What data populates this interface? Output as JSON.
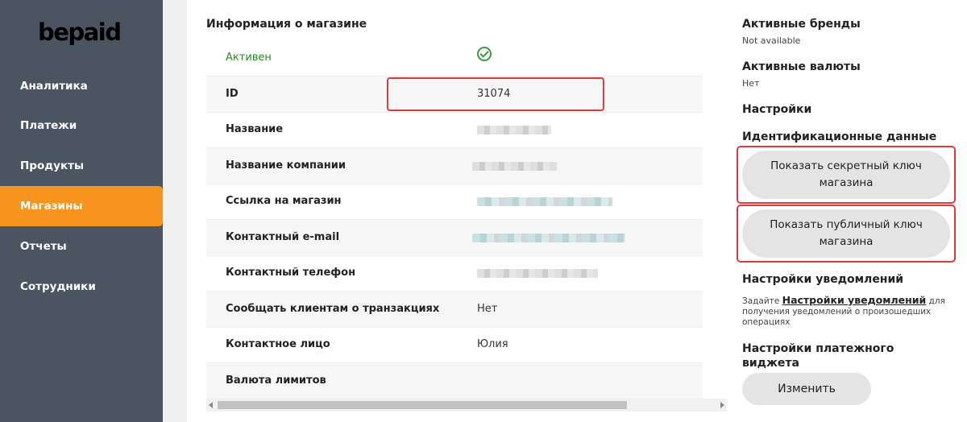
{
  "brand": {
    "logo_text": "bepaid",
    "accent": "#f7941d",
    "sidebar_bg": "#4b5562"
  },
  "sidebar": {
    "items": [
      {
        "label": "Аналитика"
      },
      {
        "label": "Платежи"
      },
      {
        "label": "Продукты"
      },
      {
        "label": "Магазины",
        "active": true
      },
      {
        "label": "Отчеты"
      },
      {
        "label": "Сотрудники"
      }
    ]
  },
  "shop_info": {
    "title": "Информация о магазине",
    "status_label": "Активен",
    "status_icon": "check-circle-icon",
    "rows": [
      {
        "label": "ID",
        "value": "31074"
      },
      {
        "label": "Название",
        "value": ""
      },
      {
        "label": "Название компании",
        "value": ""
      },
      {
        "label": "Ссылка на магазин",
        "value": ""
      },
      {
        "label": "Контактный e-mail",
        "value": ""
      },
      {
        "label": "Контактный телефон",
        "value": ""
      },
      {
        "label": "Сообщать клиентам о транзакциях",
        "value": "Нет"
      },
      {
        "label": "Контактное лицо",
        "value": "Юлия"
      },
      {
        "label": "Валюта лимитов",
        "value": ""
      }
    ]
  },
  "right_panel": {
    "active_brands": {
      "title": "Активные бренды",
      "value": "Not available"
    },
    "active_currencies": {
      "title": "Активные валюты",
      "value": "Нет"
    },
    "settings_title": "Настройки",
    "credentials_title": "Идентификационные данные",
    "show_secret_key": "Показать секретный ключ магазина",
    "show_public_key": "Показать публичный ключ магазина",
    "notifications": {
      "title": "Настройки уведомлений",
      "text_before": "Задайте ",
      "link": "Настройки уведомлений",
      "text_after": " для получения уведомлений о произошедших операциях"
    },
    "widget": {
      "title": "Настройки платежного виджета",
      "button": "Изменить"
    }
  }
}
